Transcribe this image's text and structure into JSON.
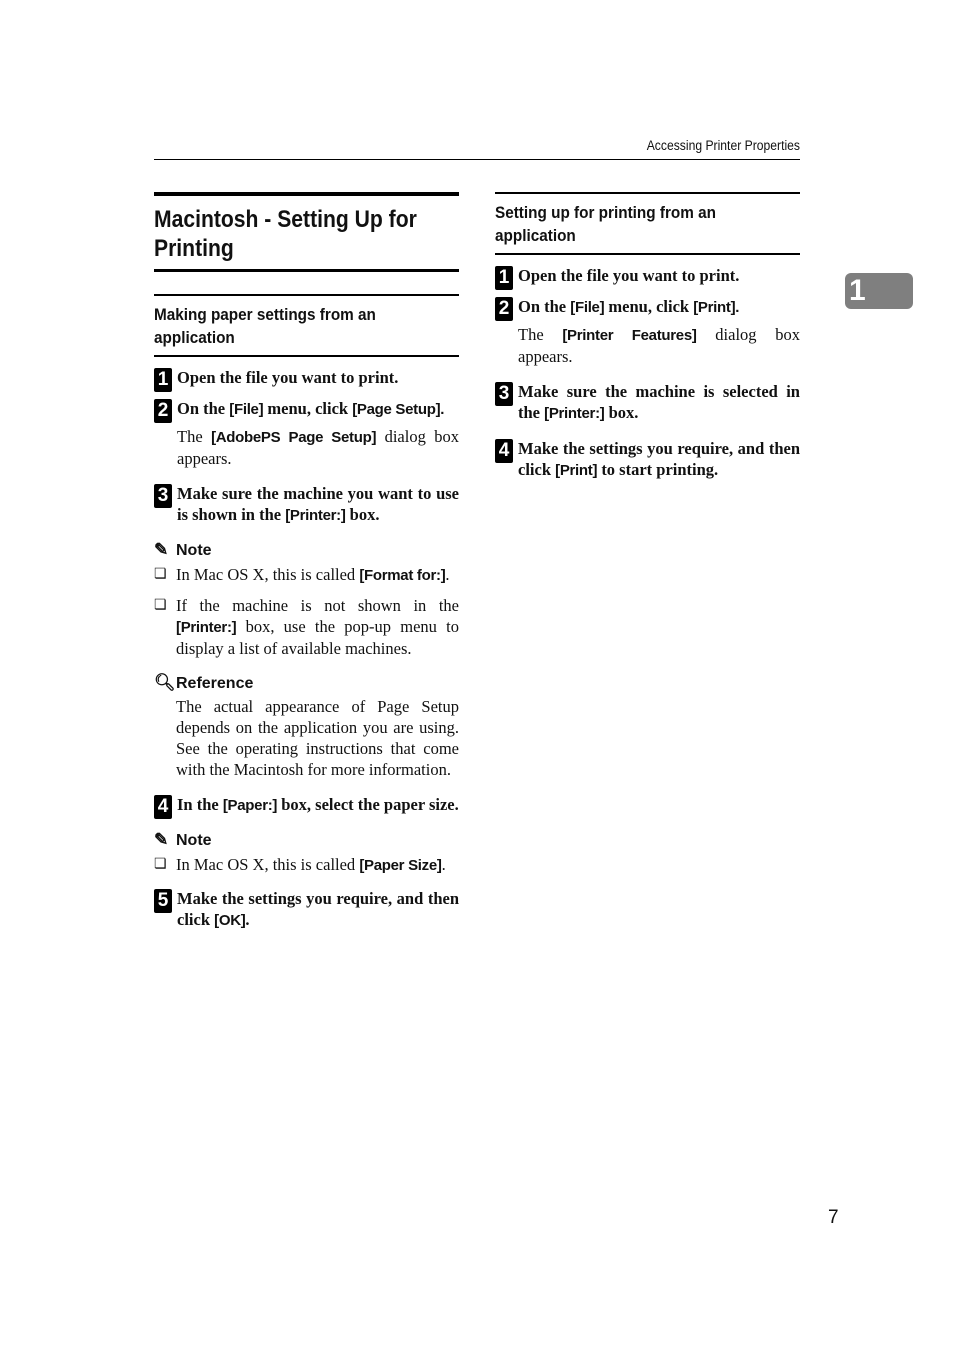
{
  "running_header": "Accessing Printer Properties",
  "chapter_tab": "1",
  "page_number": "7",
  "left": {
    "title": "Macintosh - Setting Up for Printing",
    "subtitle": "Making paper settings from an application",
    "steps": [
      {
        "num": "1",
        "pre": "Open the file you want to print.",
        "ui1": "",
        "mid": "",
        "ui2": "",
        "post": ""
      },
      {
        "num": "2",
        "pre": "On the ",
        "ui1": "[File]",
        "mid": " menu, click ",
        "ui2": "[Page Setup]",
        "post": ".",
        "body_pre": "The ",
        "body_ui": "[AdobePS Page Setup]",
        "body_post": " dialog box appears."
      },
      {
        "num": "3",
        "pre": "Make sure the machine you want to use is shown in the ",
        "ui1": "[Printer:]",
        "mid": " box.",
        "ui2": "",
        "post": ""
      },
      {
        "num": "4",
        "pre": "In the ",
        "ui1": "[Paper:]",
        "mid": " box, select the paper size.",
        "ui2": "",
        "post": ""
      },
      {
        "num": "5",
        "pre": "Make the settings you require, and then click ",
        "ui1": "[OK]",
        "mid": ".",
        "ui2": "",
        "post": ""
      }
    ],
    "note1": {
      "label": "Note",
      "items": [
        {
          "pre": "In Mac OS X, this is called ",
          "ui": "[Format for:]",
          "post": "."
        },
        {
          "pre": "If the machine is not shown in the ",
          "ui": "[Printer:]",
          "post": " box, use the pop-up menu to display a list of available machines."
        }
      ]
    },
    "reference": {
      "label": "Reference",
      "text": "The actual appearance of Page Setup depends on the application you are using. See the operating instructions that come with the Macintosh for more information."
    },
    "note2": {
      "label": "Note",
      "items": [
        {
          "pre": "In Mac OS X, this is called ",
          "ui": "[Paper Size]",
          "post": "."
        }
      ]
    }
  },
  "right": {
    "subtitle": "Setting up for printing from an application",
    "steps": [
      {
        "num": "1",
        "pre": "Open the file you want to print.",
        "ui1": "",
        "mid": "",
        "ui2": "",
        "post": ""
      },
      {
        "num": "2",
        "pre": "On the ",
        "ui1": "[File]",
        "mid": " menu, click ",
        "ui2": "[Print]",
        "post": ".",
        "body_pre": "The ",
        "body_ui": "[Printer Features]",
        "body_post": " dialog box appears."
      },
      {
        "num": "3",
        "pre": "Make sure the machine is selected in the ",
        "ui1": "[Printer:]",
        "mid": " box.",
        "ui2": "",
        "post": ""
      },
      {
        "num": "4",
        "pre": "Make the settings you require, and then click ",
        "ui1": "[Print]",
        "mid": " to start printing.",
        "ui2": "",
        "post": ""
      }
    ]
  },
  "icons": {
    "note": "pencil-icon",
    "reference": "magnifier-icon",
    "checkbox": "checkbox-icon"
  }
}
